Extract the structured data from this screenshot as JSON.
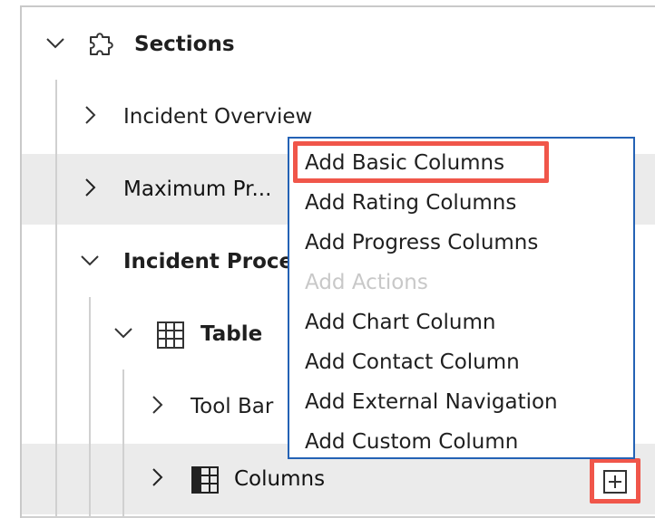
{
  "tree": {
    "sections": {
      "label": "Sections",
      "expanded": true,
      "icon": "puzzle-icon"
    },
    "incident_overview": {
      "label": "Incident Overview",
      "expanded": false
    },
    "maximum_pr": {
      "label": "Maximum Pr...",
      "expanded": false,
      "selected": true
    },
    "incident_proce": {
      "label": "Incident Proce",
      "expanded": true
    },
    "table": {
      "label": "Table",
      "expanded": true,
      "icon": "table-grid-icon"
    },
    "tool_bar": {
      "label": "Tool Bar",
      "expanded": false
    },
    "columns": {
      "label": "Columns",
      "expanded": false,
      "icon": "columns-icon",
      "selected": true
    },
    "add_button_icon": "plus-square-icon"
  },
  "context_menu": {
    "items": [
      {
        "label": "Add Basic Columns",
        "enabled": true,
        "highlighted": true
      },
      {
        "label": "Add Rating Columns",
        "enabled": true
      },
      {
        "label": "Add Progress Columns",
        "enabled": true
      },
      {
        "label": "Add Actions",
        "enabled": false
      },
      {
        "label": "Add Chart Column",
        "enabled": true
      },
      {
        "label": "Add Contact Column",
        "enabled": true
      },
      {
        "label": "Add External Navigation",
        "enabled": true
      },
      {
        "label": "Add Custom Column",
        "enabled": true
      }
    ]
  },
  "colors": {
    "highlight_border": "#f0564a",
    "menu_border": "#2462b5",
    "selected_row": "#ebebeb",
    "disabled_text": "#c8c8c8"
  }
}
